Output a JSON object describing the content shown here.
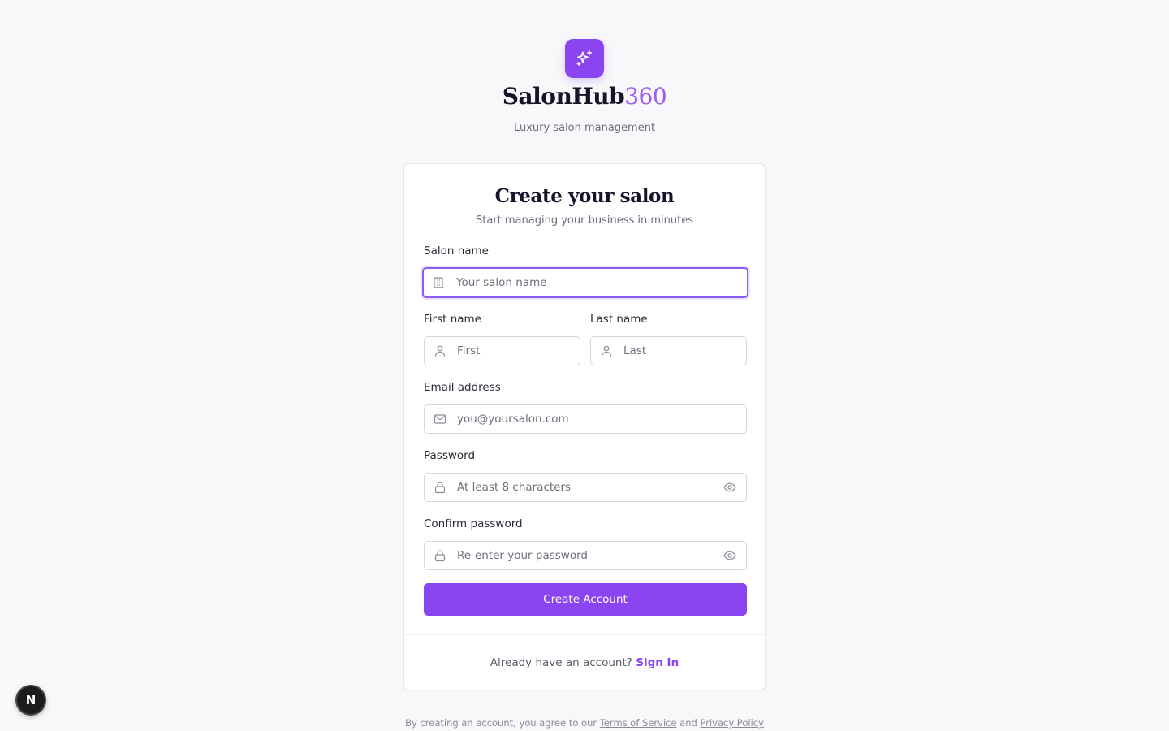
{
  "brand": {
    "name_main": "SalonHub",
    "name_accent": "360",
    "tagline": "Luxury salon management",
    "logo_icon": "sparkles-icon",
    "accent_color": "#8b45f0"
  },
  "form": {
    "title": "Create your salon",
    "subtitle": "Start managing your business in minutes",
    "salon_name": {
      "label": "Salon name",
      "placeholder": "Your salon name",
      "icon": "building-icon"
    },
    "first_name": {
      "label": "First name",
      "placeholder": "First",
      "icon": "user-icon"
    },
    "last_name": {
      "label": "Last name",
      "placeholder": "Last",
      "icon": "user-icon"
    },
    "email": {
      "label": "Email address",
      "placeholder": "you@yoursalon.com",
      "icon": "mail-icon"
    },
    "password": {
      "label": "Password",
      "placeholder": "At least 8 characters",
      "icon": "lock-icon"
    },
    "confirm_password": {
      "label": "Confirm password",
      "placeholder": "Re-enter your password",
      "icon": "lock-icon"
    },
    "submit_label": "Create Account"
  },
  "signin": {
    "prompt": "Already have an account?",
    "link": "Sign In"
  },
  "legal": {
    "prefix": "By creating an account, you agree to our",
    "terms": "Terms of Service",
    "and": "and",
    "privacy": "Privacy Policy"
  },
  "dev_badge": {
    "letter": "N"
  }
}
